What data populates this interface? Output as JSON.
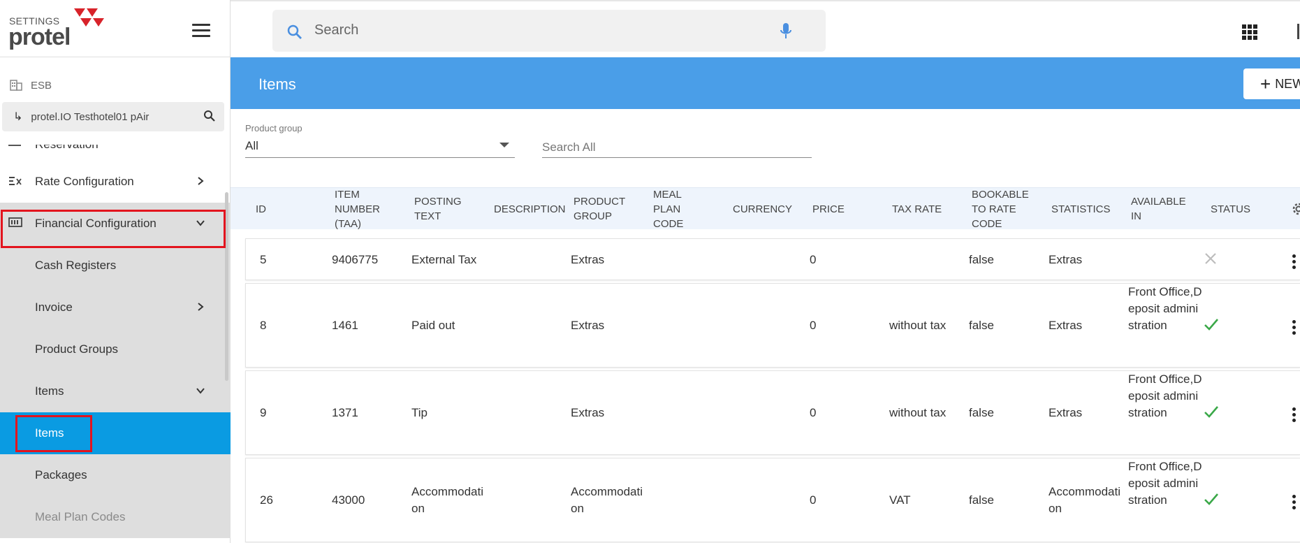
{
  "sidebar": {
    "settings_label": "SETTINGS",
    "brand": "protel",
    "property": "ESB",
    "hotel": "protel.IO Testhotel01 pAir",
    "partial_item": "Reservation",
    "items": [
      {
        "label": "Rate Configuration",
        "chevron": "right"
      },
      {
        "label": "Financial Configuration",
        "chevron": "down"
      },
      {
        "label": "Cash Registers"
      },
      {
        "label": "Invoice",
        "chevron": "right"
      },
      {
        "label": "Product Groups"
      },
      {
        "label": "Items",
        "chevron": "down"
      },
      {
        "label": "Items"
      },
      {
        "label": "Packages"
      },
      {
        "label": "Meal Plan Codes"
      }
    ]
  },
  "topbar": {
    "search_placeholder": "Search"
  },
  "header": {
    "title": "Items",
    "new_button": "NEW"
  },
  "filters": {
    "product_group_label": "Product group",
    "product_group_value": "All",
    "search_all_placeholder": "Search All"
  },
  "table": {
    "columns": {
      "id": "ID",
      "item_number": "ITEM NUMBER (TAA)",
      "posting_text": "POSTING TEXT",
      "description": "DESCRIPTION",
      "product_group": "PRODUCT GROUP",
      "meal_plan_code": "MEAL PLAN CODE",
      "currency": "CURRENCY",
      "price": "PRICE",
      "tax_rate": "TAX RATE",
      "bookable": "BOOKABLE TO RATE CODE",
      "statistics": "STATISTICS",
      "available_in": "AVAILABLE IN",
      "status": "STATUS"
    },
    "rows": [
      {
        "id": "5",
        "item_number": "9406775",
        "posting_text": "External Tax",
        "product_group": "Extras",
        "price": "0",
        "tax_rate": "",
        "bookable": "false",
        "statistics": "Extras",
        "available_in": "",
        "status": "inactive"
      },
      {
        "id": "8",
        "item_number": "1461",
        "posting_text": "Paid out",
        "product_group": "Extras",
        "price": "0",
        "tax_rate": "without tax",
        "bookable": "false",
        "statistics": "Extras",
        "available_in": "Front Office,Deposit administration",
        "status": "active"
      },
      {
        "id": "9",
        "item_number": "1371",
        "posting_text": "Tip",
        "product_group": "Extras",
        "price": "0",
        "tax_rate": "without tax",
        "bookable": "false",
        "statistics": "Extras",
        "available_in": "Front Office,Deposit administration",
        "status": "active"
      },
      {
        "id": "26",
        "item_number": "43000",
        "posting_text": "Accommodation",
        "product_group": "Accommodation",
        "price": "0",
        "tax_rate": "VAT",
        "bookable": "false",
        "statistics": "Accommodation",
        "available_in": "Front Office,Deposit administration",
        "status": "active"
      }
    ]
  },
  "colors": {
    "header_blue": "#4a9ee8",
    "active_nav": "#0a9be2",
    "highlight_red": "#e3141e",
    "check_green": "#3aa848",
    "brand_red": "#d8232a"
  },
  "icons": [
    "hamburger-icon",
    "building-icon",
    "subdirectory-arrow-icon",
    "search-icon",
    "rate-config-icon",
    "financial-config-icon",
    "chevron-right-icon",
    "chevron-down-icon",
    "mic-icon",
    "apps-grid-icon",
    "plus-icon",
    "gear-icon",
    "close-icon",
    "check-icon",
    "more-vert-icon"
  ]
}
